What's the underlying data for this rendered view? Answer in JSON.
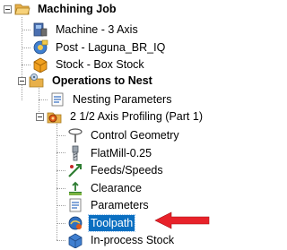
{
  "tree": {
    "root": {
      "label": "Machining Job",
      "icon": "folder-open-icon"
    },
    "items": [
      {
        "label": "Machine - 3 Axis",
        "icon": "machine-icon"
      },
      {
        "label": "Post - Laguna_BR_IQ",
        "icon": "post-processor-icon"
      },
      {
        "label": "Stock - Box Stock",
        "icon": "stock-box-icon"
      },
      {
        "label": "Operations to Nest",
        "icon": "operations-folder-icon"
      },
      {
        "label": "Nesting Parameters",
        "icon": "nesting-parameters-icon"
      },
      {
        "label": "2 1/2 Axis Profiling (Part 1)",
        "icon": "profiling-folder-icon"
      },
      {
        "label": "Control Geometry",
        "icon": "control-geometry-icon"
      },
      {
        "label": "FlatMill-0.25",
        "icon": "flatmill-tool-icon"
      },
      {
        "label": "Feeds/Speeds",
        "icon": "feeds-speeds-icon"
      },
      {
        "label": "Clearance",
        "icon": "clearance-icon"
      },
      {
        "label": "Parameters",
        "icon": "parameters-icon"
      },
      {
        "label": "Toolpath",
        "icon": "toolpath-icon",
        "selected": true
      },
      {
        "label": "In-process Stock",
        "icon": "in-process-stock-icon"
      }
    ]
  },
  "colors": {
    "selection": "#0b6fc1",
    "arrow": "#e8222a"
  }
}
